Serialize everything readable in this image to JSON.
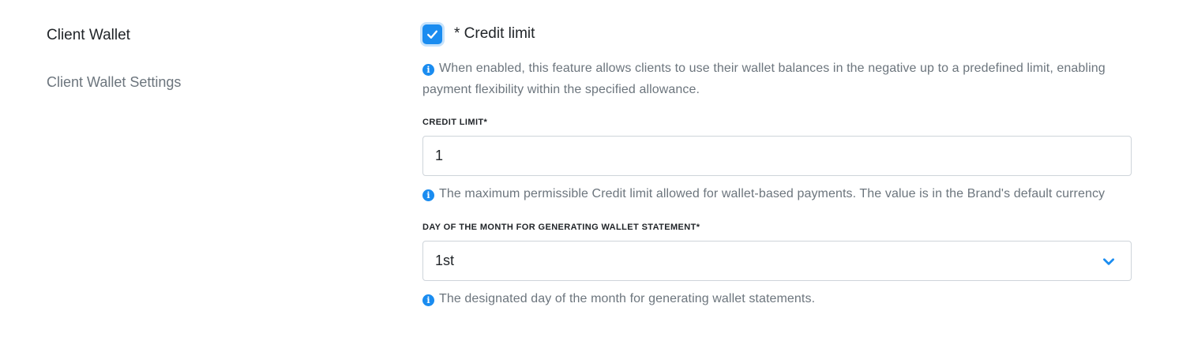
{
  "section": {
    "title": "Client Wallet",
    "subtitle": "Client Wallet Settings"
  },
  "credit_toggle": {
    "checked": true,
    "label": "* Credit limit",
    "help": "When enabled, this feature allows clients to use their wallet balances in the negative up to a predefined limit, enabling payment flexibility within the specified allowance."
  },
  "credit_limit": {
    "label": "CREDIT LIMIT*",
    "value": "1",
    "help": "The maximum permissible Credit limit allowed for wallet-based payments. The value is in the Brand's default currency"
  },
  "statement_day": {
    "label": "DAY OF THE MONTH FOR GENERATING WALLET STATEMENT*",
    "selected": "1st",
    "help": "The designated day of the month for generating wallet statements."
  },
  "colors": {
    "accent": "#1a8cf0",
    "muted_text": "#6c757d",
    "border": "#ced4da"
  },
  "icons": {
    "info": "info-circle-icon",
    "check": "check-icon",
    "dropdown": "chevron-down-icon"
  }
}
